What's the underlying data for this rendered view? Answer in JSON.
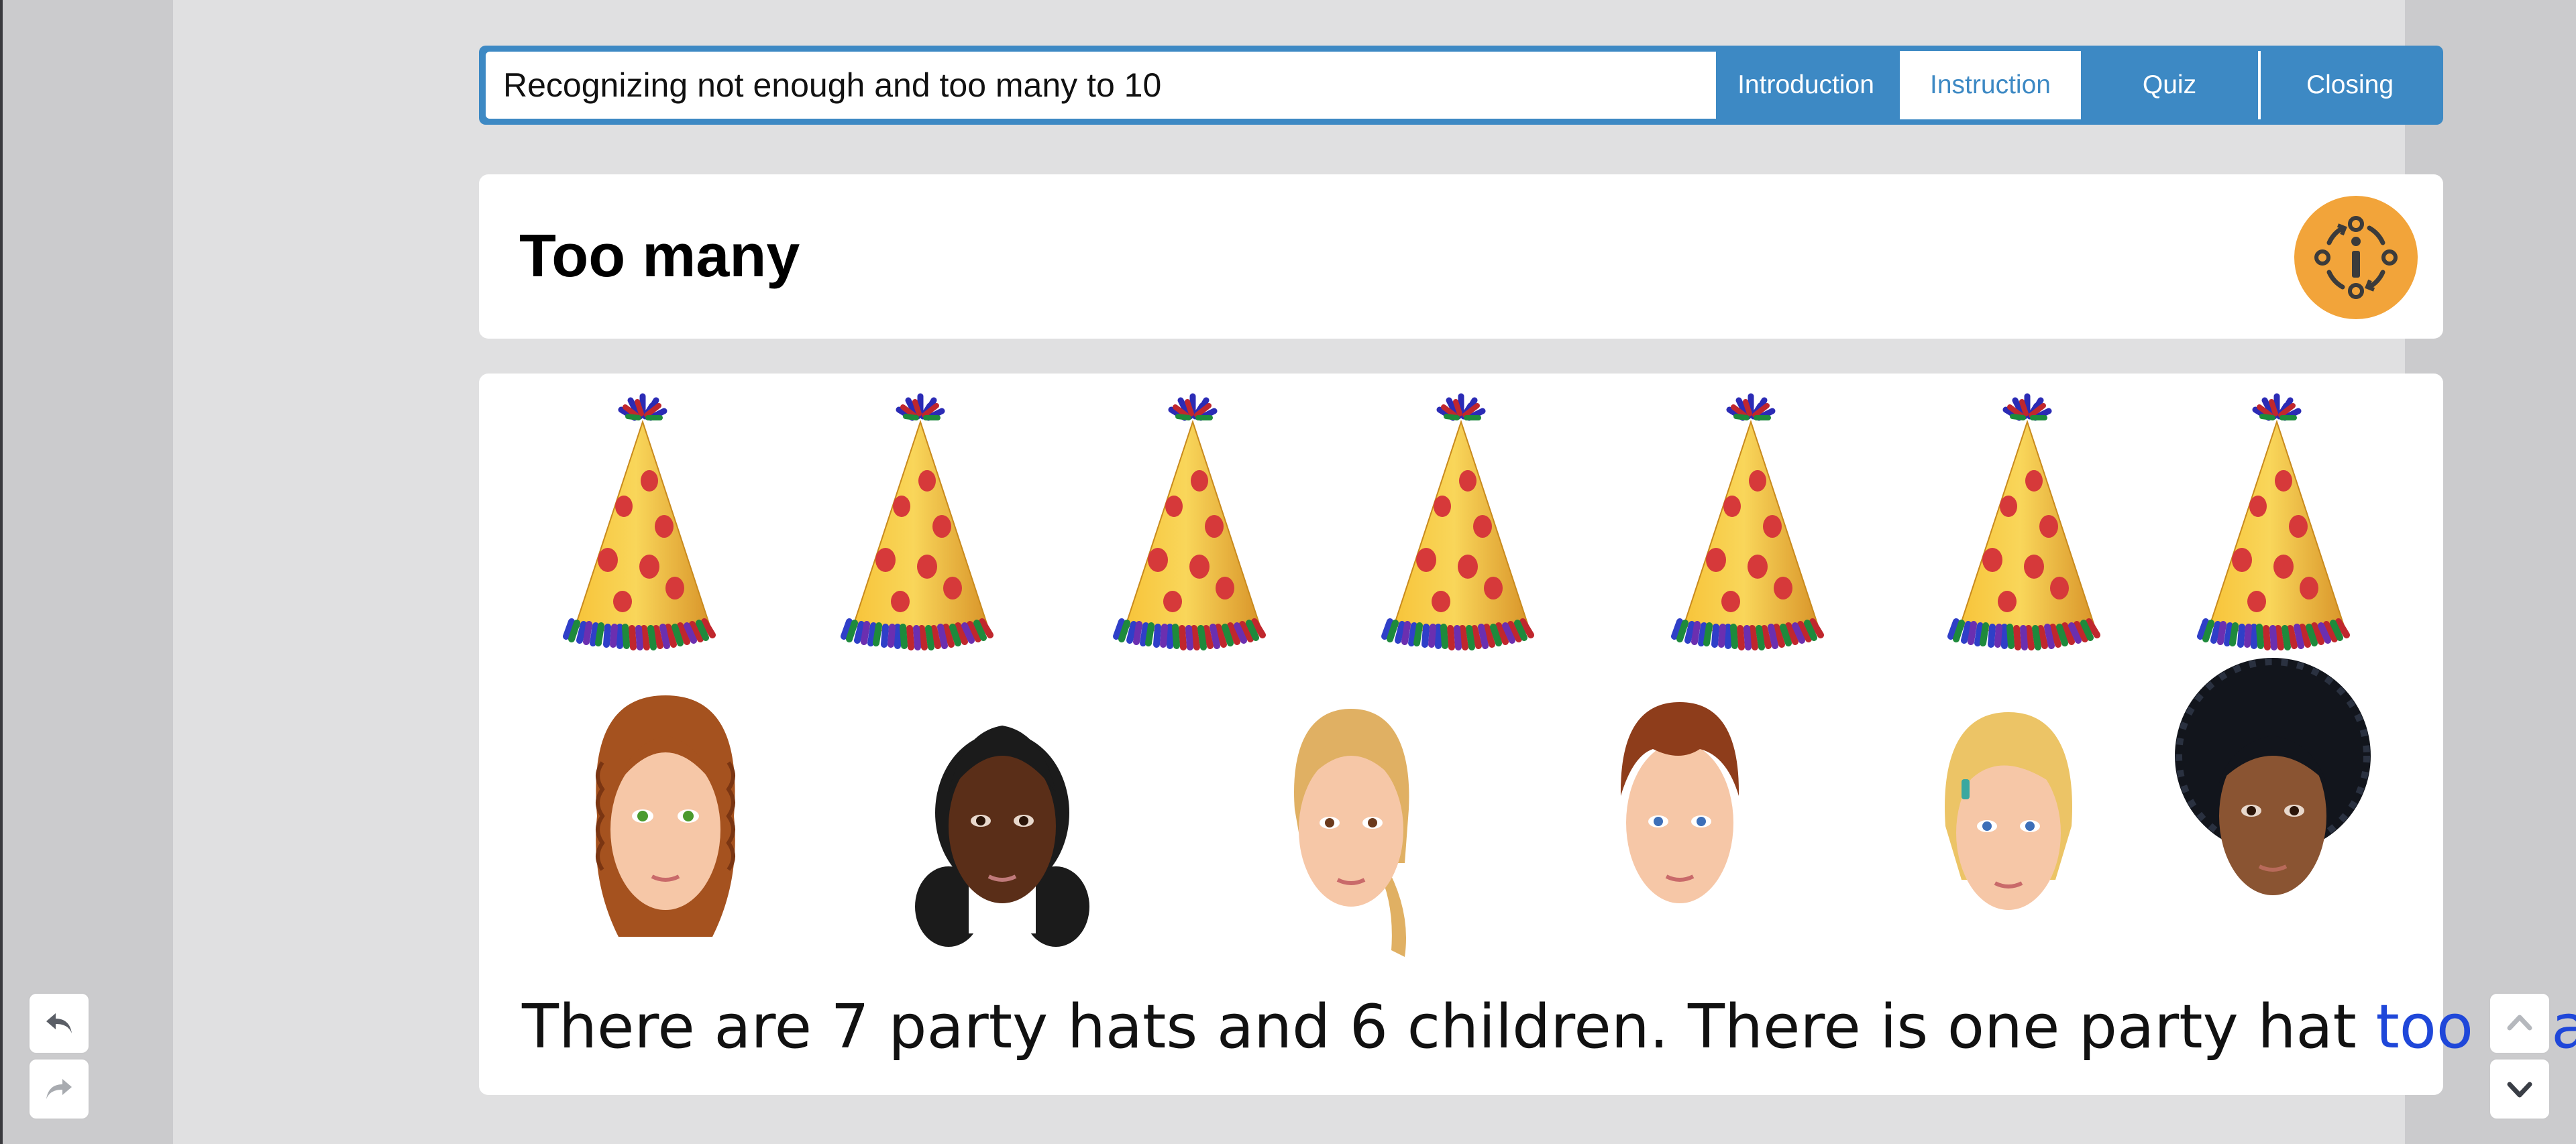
{
  "lesson": {
    "title": "Recognizing not enough and too many to 10"
  },
  "tabs": [
    {
      "label": "Introduction",
      "active": false
    },
    {
      "label": "Instruction",
      "active": true
    },
    {
      "label": "Quiz",
      "active": false
    },
    {
      "label": "Closing",
      "active": false
    }
  ],
  "page": {
    "title": "Too many",
    "info_icon": "info-cycle-icon"
  },
  "scene": {
    "hat_count": 7,
    "children": [
      {
        "hair": "curly-auburn",
        "skin": "light",
        "eyes": "green"
      },
      {
        "hair": "black-pigtails",
        "skin": "dark",
        "eyes": "brown"
      },
      {
        "hair": "blonde-ponytail",
        "skin": "light",
        "eyes": "brown"
      },
      {
        "hair": "short-auburn",
        "skin": "light",
        "eyes": "blue"
      },
      {
        "hair": "short-blonde",
        "skin": "light",
        "eyes": "blue"
      },
      {
        "hair": "black-afro",
        "skin": "brown",
        "eyes": "brown"
      }
    ]
  },
  "sentence": {
    "before": "There are 7 party hats and 6 children. There is one party hat ",
    "highlight": "too many",
    "after": "."
  },
  "nav": {
    "undo_icon": "undo-icon",
    "redo_icon": "redo-icon",
    "up_icon": "chevron-up-icon",
    "down_icon": "chevron-down-icon"
  },
  "colors": {
    "accent": "#3d89c4",
    "info": "#f2a43a",
    "highlight": "#1f47d9"
  }
}
